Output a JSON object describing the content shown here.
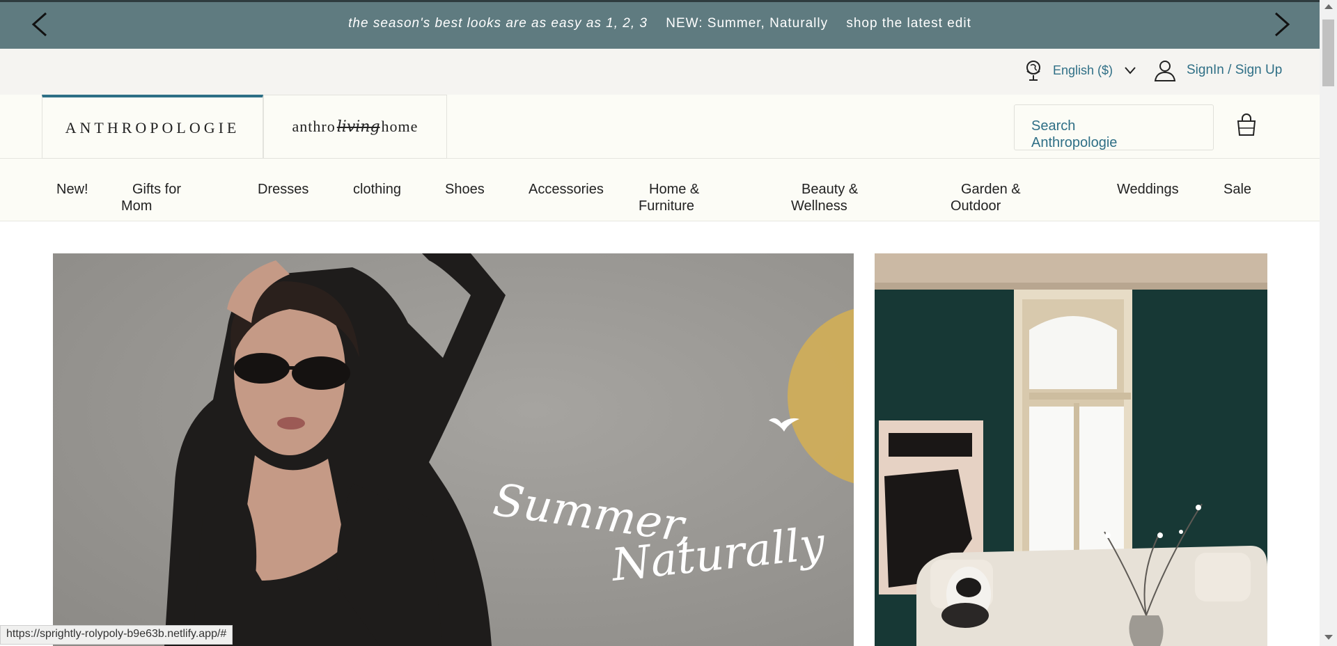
{
  "promo": {
    "messages": [
      "the season's best looks are as easy as 1, 2, 3",
      "NEW: Summer, Naturally",
      "shop the latest edit"
    ],
    "icons": {
      "prev": "chevron-left-icon",
      "next": "chevron-right-icon"
    }
  },
  "utility": {
    "language": "English ($)",
    "signin": "SignIn / Sign Up",
    "icons": {
      "globe": "globe-icon",
      "chevron": "chevron-down-icon",
      "user": "user-icon"
    }
  },
  "header": {
    "brands": [
      {
        "label": "ANTHROPOLOGIE"
      },
      {
        "label_a": "anthro",
        "label_b": "living",
        "label_c": "home"
      }
    ],
    "search_placeholder_line1": "Search",
    "search_placeholder_line2": "Anthropologie",
    "icons": {
      "bag": "shopping-bag-icon"
    }
  },
  "nav": {
    "items": [
      "New!",
      "Gifts for",
      "Mom",
      "Dresses",
      "clothing",
      "Shoes",
      "Accessories",
      "Home &",
      "Furniture",
      "Beauty &",
      "Wellness",
      "Garden &",
      "Outdoor",
      "Weddings",
      "Sale"
    ]
  },
  "hero": {
    "left_script": "Summer, Naturally"
  },
  "status_url": "https://sprightly-rolypoly-b9e63b.netlify.app/#",
  "colors": {
    "promo_bg": "#5f7b80",
    "accent": "#2f6f86",
    "utility_bg": "#f5f4f1",
    "header_bg": "#fcfcf6"
  }
}
